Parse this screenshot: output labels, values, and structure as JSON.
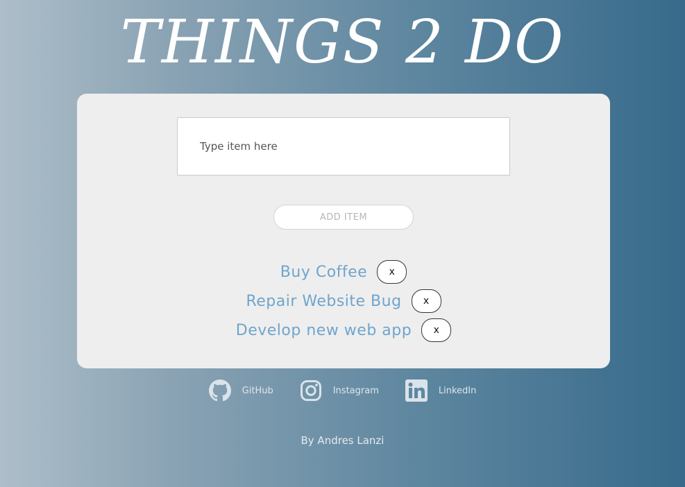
{
  "header": {
    "title": "THINGS 2 DO"
  },
  "form": {
    "input_value": "",
    "input_placeholder": "Type item here",
    "add_button_label": "ADD ITEM"
  },
  "todos": [
    {
      "text": "Buy Coffee",
      "delete_label": "x"
    },
    {
      "text": "Repair Website Bug",
      "delete_label": "x"
    },
    {
      "text": "Develop new web app",
      "delete_label": "x"
    }
  ],
  "social": [
    {
      "label": "GitHub",
      "icon": "github-icon"
    },
    {
      "label": "Instagram",
      "icon": "instagram-icon"
    },
    {
      "label": "LinkedIn",
      "icon": "linkedin-icon"
    }
  ],
  "footer": {
    "credit": "By Andres Lanzi"
  },
  "colors": {
    "gradient_left": "#adbec9",
    "gradient_right": "#376a8b",
    "card_background": "#eeeeee",
    "todo_text": "#6fa5cc",
    "social_icon": "#d9e3ea"
  }
}
